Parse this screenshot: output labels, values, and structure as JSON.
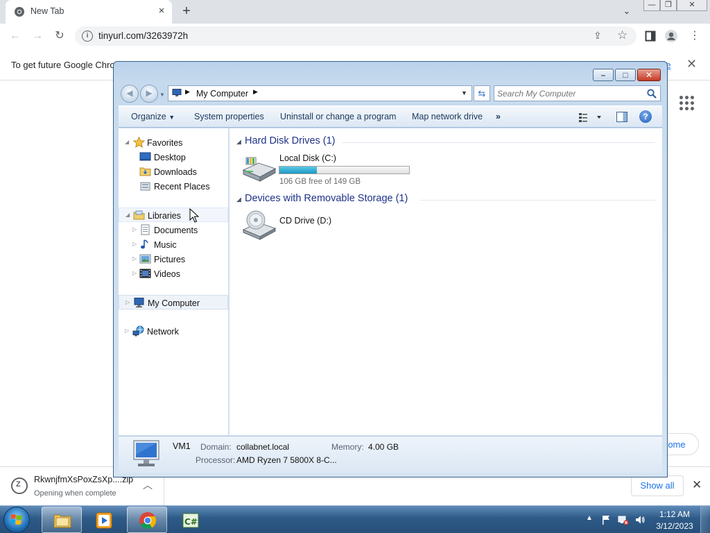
{
  "browser": {
    "tab_title": "New Tab",
    "tab_close": "×",
    "new_tab": "+",
    "url": "tinyurl.com/3263972h",
    "window_buttons": {
      "minimize": "—",
      "restore": "❐",
      "close": "✕"
    },
    "infobar": {
      "message": "To get future Google Chro",
      "link_fragment": "re",
      "close": "✕"
    },
    "customize_fragment": "rome"
  },
  "explorer": {
    "breadcrumb": "My Computer",
    "search_placeholder": "Search My Computer",
    "toolbar": {
      "organize": "Organize",
      "system_properties": "System properties",
      "uninstall": "Uninstall or change a program",
      "map_drive": "Map network drive",
      "more": "»"
    },
    "nav": {
      "favorites": "Favorites",
      "desktop": "Desktop",
      "downloads": "Downloads",
      "recent_places": "Recent Places",
      "libraries": "Libraries",
      "documents": "Documents",
      "music": "Music",
      "pictures": "Pictures",
      "videos": "Videos",
      "my_computer": "My Computer",
      "network": "Network"
    },
    "groups": [
      {
        "title": "Hard Disk Drives (1)",
        "drives": [
          {
            "name": "Local Disk (C:)",
            "free_text": "106 GB free of 149 GB",
            "used_fraction": 0.29
          }
        ]
      },
      {
        "title": "Devices with Removable Storage (1)",
        "drives": [
          {
            "name": "CD Drive (D:)"
          }
        ]
      }
    ],
    "details": {
      "computer_name": "VM1",
      "domain_label": "Domain:",
      "domain_value": "collabnet.local",
      "memory_label": "Memory:",
      "memory_value": "4.00 GB",
      "processor_label": "Processor:",
      "processor_value": "AMD Ryzen 7 5800X 8-C..."
    }
  },
  "downloads": {
    "file_name": "RkwnjfmXsPoxZsXp....zip",
    "status": "Opening when complete",
    "show_all": "Show all",
    "close": "✕"
  },
  "taskbar": {
    "time": "1:12 AM",
    "date": "3/12/2023",
    "apps": [
      "windows-explorer",
      "media-player",
      "google-chrome",
      "csharp-ide"
    ]
  },
  "colors": {
    "aero_title": "#c6daee",
    "group_header": "#1e3287",
    "chrome_link": "#1a73e8",
    "taskbar": "#2e5a87"
  }
}
